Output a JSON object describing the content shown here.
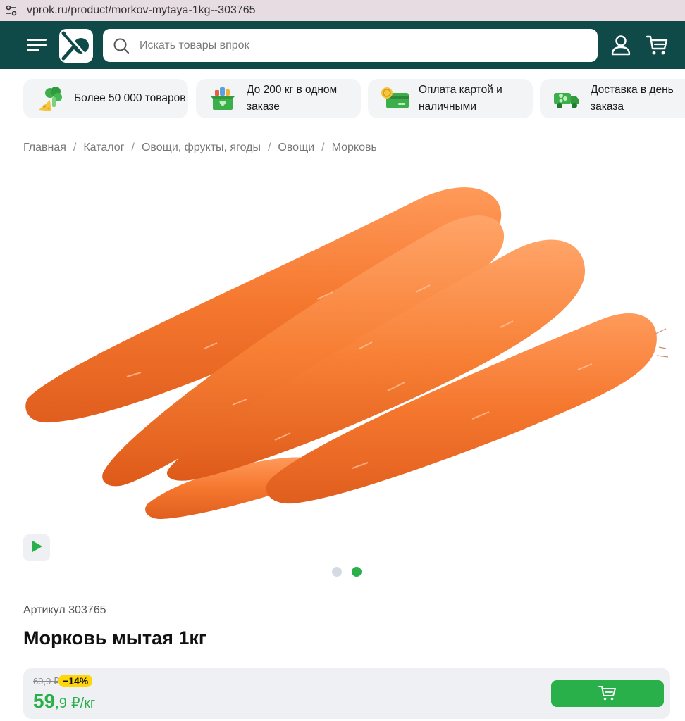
{
  "browser": {
    "url": "vprok.ru/product/morkov-mytaya-1kg--303765",
    "site_info_icon": "tune-icon"
  },
  "header": {
    "menu_icon": "hamburger-menu-icon",
    "logo_icon": "vprok-logo-icon",
    "search": {
      "placeholder": "Искать товары впрок",
      "value": ""
    },
    "user_icon": "user-icon",
    "cart_icon": "cart-icon",
    "colors": {
      "background": "#0f4a48"
    }
  },
  "benefits": [
    {
      "icon": "broccoli-cheese-icon",
      "text": "Более 50 000 товаров"
    },
    {
      "icon": "grocery-box-icon",
      "text": "До 200 кг в одном заказе"
    },
    {
      "icon": "card-coin-icon",
      "text": "Оплата картой и наличными"
    },
    {
      "icon": "delivery-truck-icon",
      "text": "Доставка в день заказа"
    }
  ],
  "breadcrumb": [
    {
      "label": "Главная"
    },
    {
      "label": "Каталог"
    },
    {
      "label": "Овощи, фрукты, ягоды"
    },
    {
      "label": "Овощи"
    },
    {
      "label": "Морковь"
    }
  ],
  "breadcrumb_separator": "/",
  "gallery": {
    "video_icon": "play-icon",
    "slides_count": 2,
    "active_slide": 2
  },
  "product": {
    "article_label": "Артикул",
    "article_number": "303765",
    "title": "Морковь мытая 1кг"
  },
  "price": {
    "old": "69,9 ₽",
    "discount": "−14%",
    "current_int": "59",
    "current_frac": ",9",
    "unit": "₽/кг",
    "add_to_cart_icon": "cart-add-icon",
    "colors": {
      "accent": "#2ab04a",
      "badge": "#ffd60a"
    }
  }
}
